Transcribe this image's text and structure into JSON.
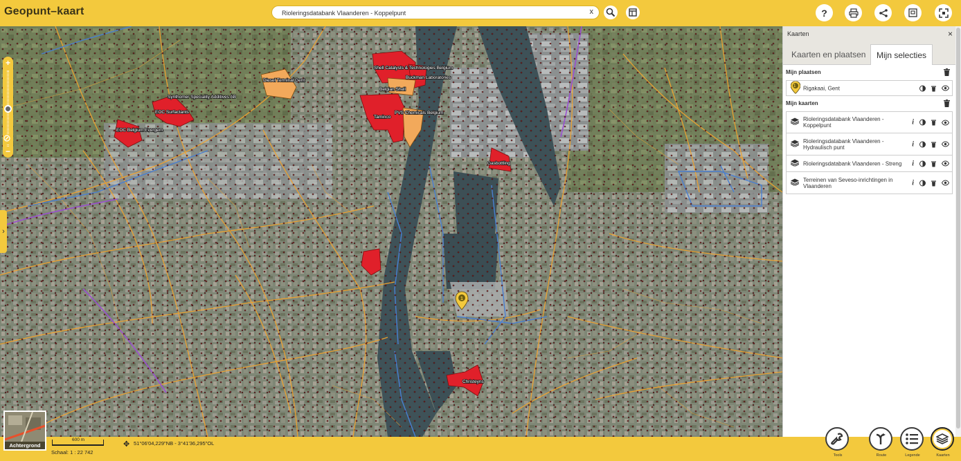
{
  "app": {
    "title": "Geopunt–kaart"
  },
  "search": {
    "value": "Rioleringsdatabank Vlaanderen - Koppelpunt",
    "clear": "x"
  },
  "toolbar": {
    "help": "?"
  },
  "map": {
    "labels": [
      "Synthomer Speciality Additives AB",
      "EOC Surfactants",
      "EOC Belgium Evergem",
      "Diesel Terminal Gent",
      "Shell Catalysts & Technologies Belgium",
      "Buckman Laboratories",
      "Belgian Shell",
      "Taminco",
      "PVS Chemicals Belgium",
      "Gasbottling",
      "Christeyns"
    ],
    "pin_number": "1"
  },
  "bottom": {
    "background_label": "Achtergrond",
    "scale_text": "600 m",
    "scale_label": "Schaal: 1 : 22 742",
    "coordinates": "51°06'04,229\"NB - 3°41'36,295\"OL"
  },
  "panel": {
    "title": "Kaarten",
    "close": "×",
    "tabs": [
      {
        "label": "Kaarten en plaatsen",
        "active": false
      },
      {
        "label": "Mijn selecties",
        "active": true
      }
    ],
    "places_header": "Mijn plaatsen",
    "places": [
      {
        "label": "Rigakaai, Gent",
        "number": "1"
      }
    ],
    "maps_header": "Mijn kaarten",
    "maps": [
      {
        "label": "Rioleringsdatabank Vlaanderen - Koppelpunt",
        "info": "i"
      },
      {
        "label": "Rioleringsdatabank Vlaanderen - Hydraulisch punt",
        "info": "i"
      },
      {
        "label": "Rioleringsdatabank Vlaanderen - Streng",
        "info": "i"
      },
      {
        "label": "Terreinen van Seveso-inrichtingen in Vlaanderen",
        "info": "i"
      }
    ]
  },
  "tools": [
    {
      "label": "Tools",
      "icon": "wrench-icon"
    },
    {
      "label": "Route",
      "icon": "route-icon"
    },
    {
      "label": "Legende",
      "icon": "list-icon"
    },
    {
      "label": "Kaarten",
      "icon": "layers-icon"
    }
  ],
  "colors": {
    "accent": "#f3c93d",
    "seveso_red": "#e0202a",
    "seveso_orange": "#f2a95b",
    "sewer_orange": "#f0a22e",
    "sewer_blue": "#4a7fd0"
  }
}
